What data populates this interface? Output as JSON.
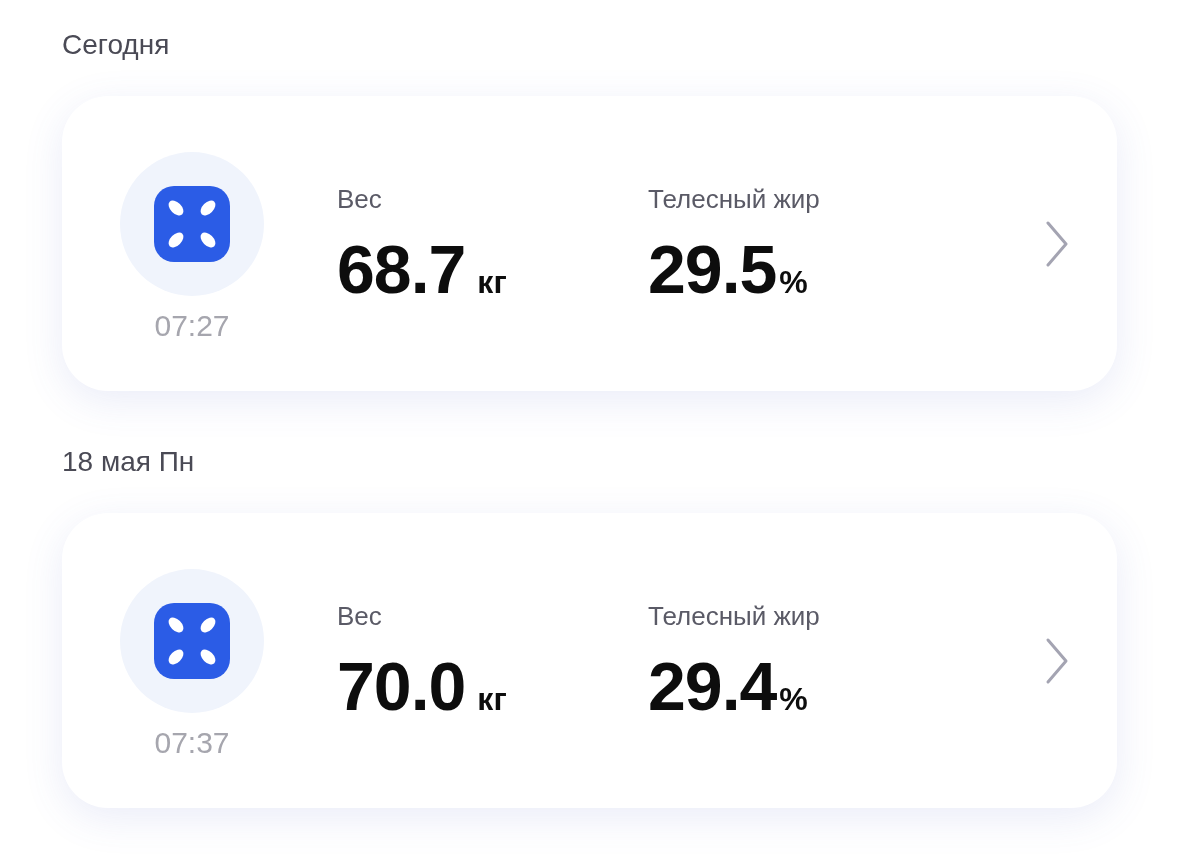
{
  "sections": [
    {
      "date": "Сегодня",
      "record": {
        "time": "07:27",
        "metrics": [
          {
            "label": "Вес",
            "value": "68.7",
            "unit": "кг"
          },
          {
            "label": "Телесный жир",
            "value": "29.5",
            "unit": "%"
          }
        ]
      }
    },
    {
      "date": "18 мая Пн",
      "record": {
        "time": "07:37",
        "metrics": [
          {
            "label": "Вес",
            "value": "70.0",
            "unit": "кг"
          },
          {
            "label": "Телесный жир",
            "value": "29.4",
            "unit": "%"
          }
        ]
      }
    }
  ]
}
